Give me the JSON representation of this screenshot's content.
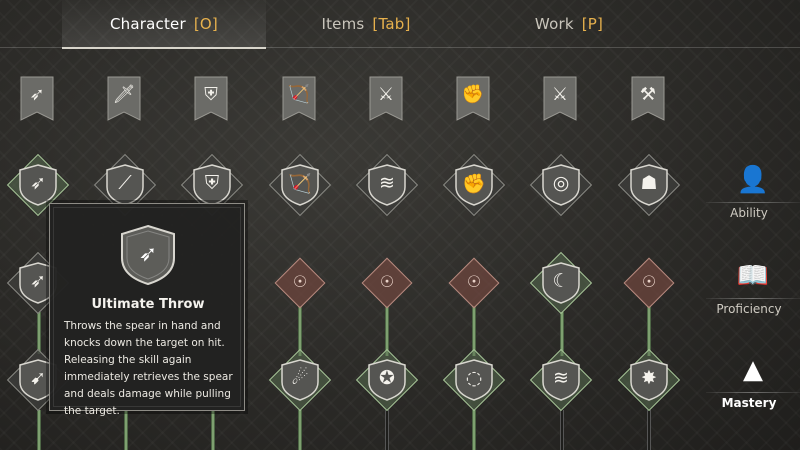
{
  "tabs": [
    {
      "label": "Character",
      "key": "[O]"
    },
    {
      "label": "Items",
      "key": "[Tab]"
    },
    {
      "label": "Work",
      "key": "[P]"
    }
  ],
  "weapons": [
    {
      "icon": "spear-icon",
      "glyph": "➶"
    },
    {
      "icon": "sword-icon",
      "glyph": "🗡"
    },
    {
      "icon": "shield-icon",
      "glyph": "⛨"
    },
    {
      "icon": "bow-icon",
      "glyph": "🏹"
    },
    {
      "icon": "dual-blades-icon",
      "glyph": "⚔"
    },
    {
      "icon": "gauntlet-icon",
      "glyph": "✊"
    },
    {
      "icon": "greatsword-icon",
      "glyph": "⚔"
    },
    {
      "icon": "hammer-icon",
      "glyph": "⚒"
    }
  ],
  "skill_row_1": [
    {
      "icon": "spear-throw-icon",
      "glyph": "➶",
      "style": "green"
    },
    {
      "icon": "sword-slash-icon",
      "glyph": "⟋",
      "style": "gray"
    },
    {
      "icon": "shield-bash-icon",
      "glyph": "⛨",
      "style": "gray"
    },
    {
      "icon": "archer-icon",
      "glyph": "🏹",
      "style": "gray"
    },
    {
      "icon": "blade-flurry-icon",
      "glyph": "≋",
      "style": "gray"
    },
    {
      "icon": "punch-icon",
      "glyph": "✊",
      "style": "gray"
    },
    {
      "icon": "whirl-slash-icon",
      "glyph": "◎",
      "style": "gray"
    },
    {
      "icon": "strongman-icon",
      "glyph": "☗",
      "style": "gray"
    }
  ],
  "skill_row_2": [
    {
      "icon": "spear-volley-icon",
      "glyph": "➶",
      "style": "gray"
    },
    {
      "icon": "mind-icon",
      "glyph": "☉",
      "style": "red"
    },
    {
      "icon": "mind-icon",
      "glyph": "☉",
      "style": "red"
    },
    {
      "icon": "mind-icon",
      "glyph": "☉",
      "style": "red"
    },
    {
      "icon": "sweep-icon",
      "glyph": "☾",
      "style": "green"
    },
    {
      "icon": "mind-icon",
      "glyph": "☉",
      "style": "red"
    }
  ],
  "skill_row_3": [
    {
      "icon": "lunge-icon",
      "glyph": "➹",
      "style": "gray"
    },
    {
      "icon": "cyclone-icon",
      "glyph": "☄",
      "style": "green"
    },
    {
      "icon": "spin-kick-icon",
      "glyph": "✪",
      "style": "green"
    },
    {
      "icon": "vortex-icon",
      "glyph": "◌",
      "style": "green"
    },
    {
      "icon": "rend-icon",
      "glyph": "≋",
      "style": "green"
    },
    {
      "icon": "impact-icon",
      "glyph": "✸",
      "style": "green"
    }
  ],
  "tooltip": {
    "icon": "spear-throw-icon",
    "glyph": "➶",
    "name": "Ultimate Throw",
    "description": "Throws the spear in hand and knocks down the target on hit. Releasing the skill again immediately retrieves the spear and deals damage while pulling the target."
  },
  "sidebar": [
    {
      "label": "Ability",
      "icon": "ability-icon",
      "glyph": "👤"
    },
    {
      "label": "Proficiency",
      "icon": "book-icon",
      "glyph": "📖"
    },
    {
      "label": "Mastery",
      "icon": "mastery-icon",
      "glyph": "▲"
    }
  ],
  "colors": {
    "accent_key": "#e7b14d",
    "node_green": "#a9c79a",
    "node_red": "#b78a7f",
    "connector_green": "#7ea070"
  }
}
